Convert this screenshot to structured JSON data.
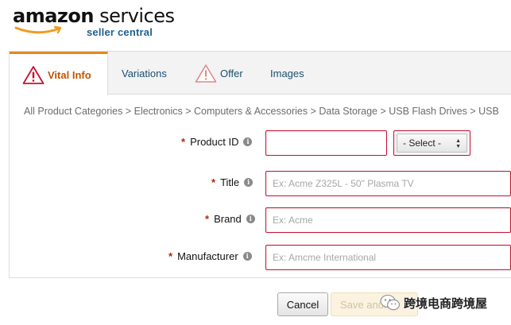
{
  "logo": {
    "brand_bold": "amazon",
    "brand_rest": " services",
    "subtitle": "seller central"
  },
  "tabs": [
    {
      "label": "Vital Info",
      "active": true,
      "warning": true
    },
    {
      "label": "Variations",
      "active": false,
      "warning": false
    },
    {
      "label": "Offer",
      "active": false,
      "warning": true
    },
    {
      "label": "Images",
      "active": false,
      "warning": false
    }
  ],
  "breadcrumb": "All Product Categories > Electronics > Computers & Accessories > Data Storage > USB Flash Drives > USB",
  "form": {
    "product_id": {
      "label": "Product ID",
      "value": "",
      "select": "- Select -"
    },
    "title": {
      "label": "Title",
      "placeholder": "Ex: Acme Z325L - 50\" Plasma TV"
    },
    "brand": {
      "label": "Brand",
      "placeholder": "Ex: Acme"
    },
    "manufacturer": {
      "label": "Manufacturer",
      "placeholder": "Ex: Amcme International"
    },
    "required_mark": "*",
    "info_glyph": "i"
  },
  "buttons": {
    "cancel": "Cancel",
    "save": "Save and..."
  },
  "watermark": {
    "text": "跨境电商跨境屋"
  },
  "colors": {
    "accent": "#e3891f",
    "active_tab_text": "#c45500",
    "link": "#1a4f6e",
    "error_border": "#c8102e",
    "required": "#b12704"
  }
}
